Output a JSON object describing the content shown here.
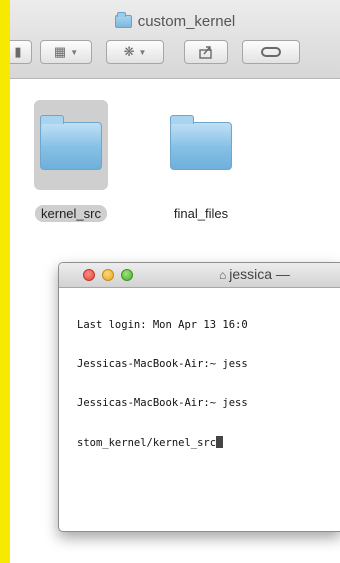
{
  "finder": {
    "title": "custom_kernel",
    "toolbar": {
      "nav_icon": "back-forward-icon",
      "view_icon": "list-view-icon",
      "action_icon": "gear-icon",
      "share_icon": "share-icon",
      "tag_icon": "tag-icon"
    },
    "items": [
      {
        "name": "kernel_src",
        "selected": true
      },
      {
        "name": "final_files",
        "selected": false
      }
    ]
  },
  "terminal": {
    "title": "jessica —",
    "lines": [
      "Last login: Mon Apr 13 16:0",
      "Jessicas-MacBook-Air:~ jess",
      "Jessicas-MacBook-Air:~ jess",
      "stom_kernel/kernel_src"
    ]
  },
  "colors": {
    "background": "#f6ea00",
    "folder_blue": "#84bfe5",
    "close": "#e0443a",
    "minimize": "#e3a925",
    "zoom": "#4cae30"
  }
}
